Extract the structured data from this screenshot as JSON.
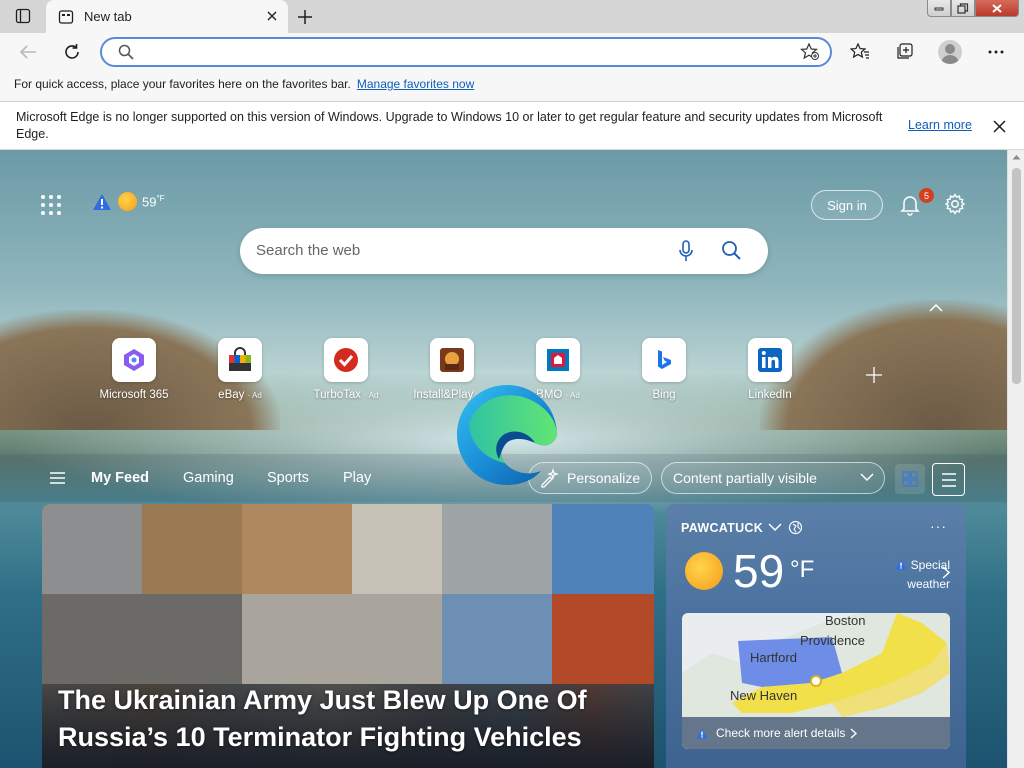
{
  "tab": {
    "title": "New tab"
  },
  "address": {
    "placeholder": ""
  },
  "favorites_bar": {
    "text": "For quick access, place your favorites here on the favorites bar.",
    "link": "Manage favorites now"
  },
  "infobar": {
    "message": "Microsoft Edge is no longer supported on this version of Windows. Upgrade to Windows 10 or later to get regular feature and security updates from Microsoft Edge.",
    "link": "Learn more"
  },
  "top": {
    "temp": "59",
    "temp_unit": "°F",
    "signin": "Sign in",
    "notif_count": "5"
  },
  "search": {
    "placeholder": "Search the web"
  },
  "quick_links": [
    {
      "label": "Microsoft 365",
      "ad": ""
    },
    {
      "label": "eBay",
      "ad": "· Ad"
    },
    {
      "label": "TurboTax",
      "ad": "· Ad"
    },
    {
      "label": "Install&Play",
      "ad": "· Ad"
    },
    {
      "label": "BMO",
      "ad": "· Ad"
    },
    {
      "label": "Bing",
      "ad": ""
    },
    {
      "label": "LinkedIn",
      "ad": ""
    }
  ],
  "feed_nav": {
    "items": [
      "My Feed",
      "Gaming",
      "Sports",
      "Play"
    ],
    "more": "...",
    "personalize": "Personalize",
    "content_visibility": "Content partially visible"
  },
  "news": {
    "headline": "The Ukrainian Army Just Blew Up One Of Russia’s 10 Terminator Fighting Vehicles"
  },
  "weather": {
    "location": "PAWCATUCK",
    "more": "···",
    "temp": "59",
    "unit": "°F",
    "alert_line1": "Special",
    "alert_line2": "weather",
    "map_labels": [
      "Boston",
      "Providence",
      "Hartford",
      "New Haven"
    ],
    "map_footer": "Check more alert details"
  },
  "colors": {
    "accent": "#0f5fb8",
    "sun": "#f79a1a",
    "badge": "#d2401f"
  }
}
